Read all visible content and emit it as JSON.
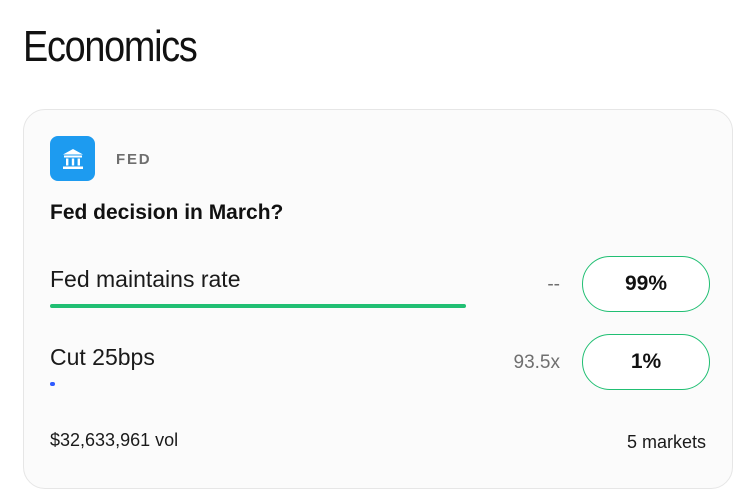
{
  "section": {
    "title": "Economics"
  },
  "card": {
    "category_icon": "bank-building-icon",
    "category_label": "FED",
    "question": "Fed decision in March?",
    "outcomes": [
      {
        "label": "Fed maintains rate",
        "multiplier": "--",
        "chance_label": "99%",
        "chance_fraction": 0.99,
        "bar_color": "#21bf73"
      },
      {
        "label": "Cut 25bps",
        "multiplier": "93.5x",
        "chance_label": "1%",
        "chance_fraction": 0.01,
        "bar_color": "#2f5bff"
      }
    ],
    "volume": "$32,633,961 vol",
    "markets_count": "5 markets"
  },
  "colors": {
    "accent_green": "#21bf73",
    "icon_blue": "#1d9bf0",
    "cut_blue": "#2f5bff"
  }
}
